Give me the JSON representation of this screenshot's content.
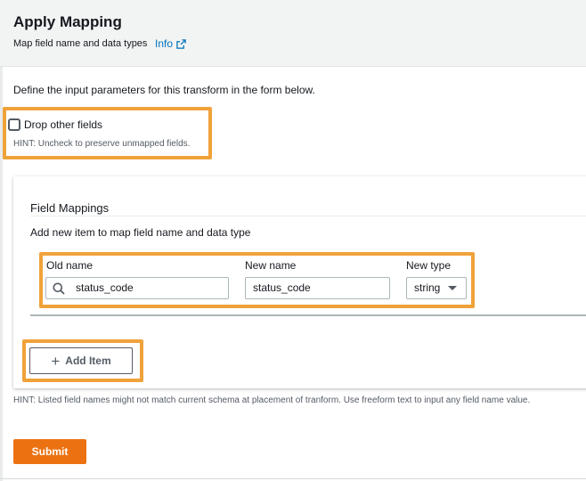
{
  "header": {
    "title": "Apply Mapping",
    "subtitle": "Map field name and data types",
    "info_label": "Info"
  },
  "intro": "Define the input parameters for this transform in the form below.",
  "drop_fields": {
    "label": "Drop other fields",
    "checked": false,
    "hint": "HINT: Uncheck to preserve unmapped fields."
  },
  "field_mappings": {
    "title": "Field Mappings",
    "description": "Add new item to map field name and data type",
    "columns": {
      "old_name": "Old name",
      "new_name": "New name",
      "new_type": "New type"
    },
    "rows": [
      {
        "old_name": "status_code",
        "new_name": "status_code",
        "new_type": "string"
      }
    ],
    "add_item_label": "Add Item"
  },
  "hint_bottom": "HINT: Listed field names might not match current schema at placement of tranform. Use freeform text to input any field name value.",
  "submit_label": "Submit",
  "colors": {
    "highlight": "#f0a23a",
    "primary": "#ec7211",
    "link": "#0073bb"
  },
  "icons": [
    "external-link-icon",
    "search-icon",
    "caret-down-icon",
    "plus-icon"
  ]
}
